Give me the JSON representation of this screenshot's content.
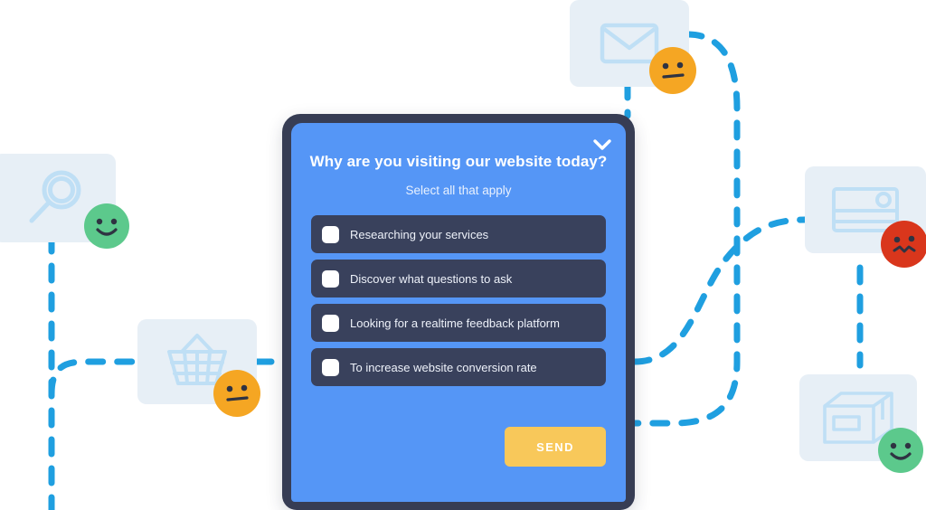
{
  "survey": {
    "title": "Why are you visiting our website today?",
    "subtitle": "Select all that apply",
    "collapse_icon": "chevron-down-icon",
    "options": [
      {
        "label": "Researching your services",
        "checked": false
      },
      {
        "label": "Discover what questions to ask",
        "checked": false
      },
      {
        "label": "Looking for a realtime feedback platform",
        "checked": false
      },
      {
        "label": "To increase website conversion rate",
        "checked": false
      }
    ],
    "send_label": "SEND",
    "colors": {
      "modal_background": "#5596f6",
      "frame": "#373d54",
      "option_row": "#39415c",
      "checkbox": "#ffffff",
      "send_button": "#f8c85a",
      "title_text": "#ffffff"
    }
  },
  "cards": [
    {
      "icon": "search-magnifier-icon",
      "emoji": "happy-face",
      "emoji_color": "#5cc98c"
    },
    {
      "icon": "envelope-mail-icon",
      "emoji": "neutral-face",
      "emoji_color": "#f5a623"
    },
    {
      "icon": "shopping-basket-icon",
      "emoji": "neutral-face",
      "emoji_color": "#f5a623"
    },
    {
      "icon": "credit-card-icon",
      "emoji": "angry-face",
      "emoji_color": "#d9361c"
    },
    {
      "icon": "package-box-icon",
      "emoji": "happy-face",
      "emoji_color": "#5cc98c"
    }
  ],
  "palette": {
    "card_background": "#e7eff6",
    "card_icon_stroke": "#bfdff5",
    "connector_dash": "#1f9fe0",
    "page_background": "#ffffff"
  }
}
